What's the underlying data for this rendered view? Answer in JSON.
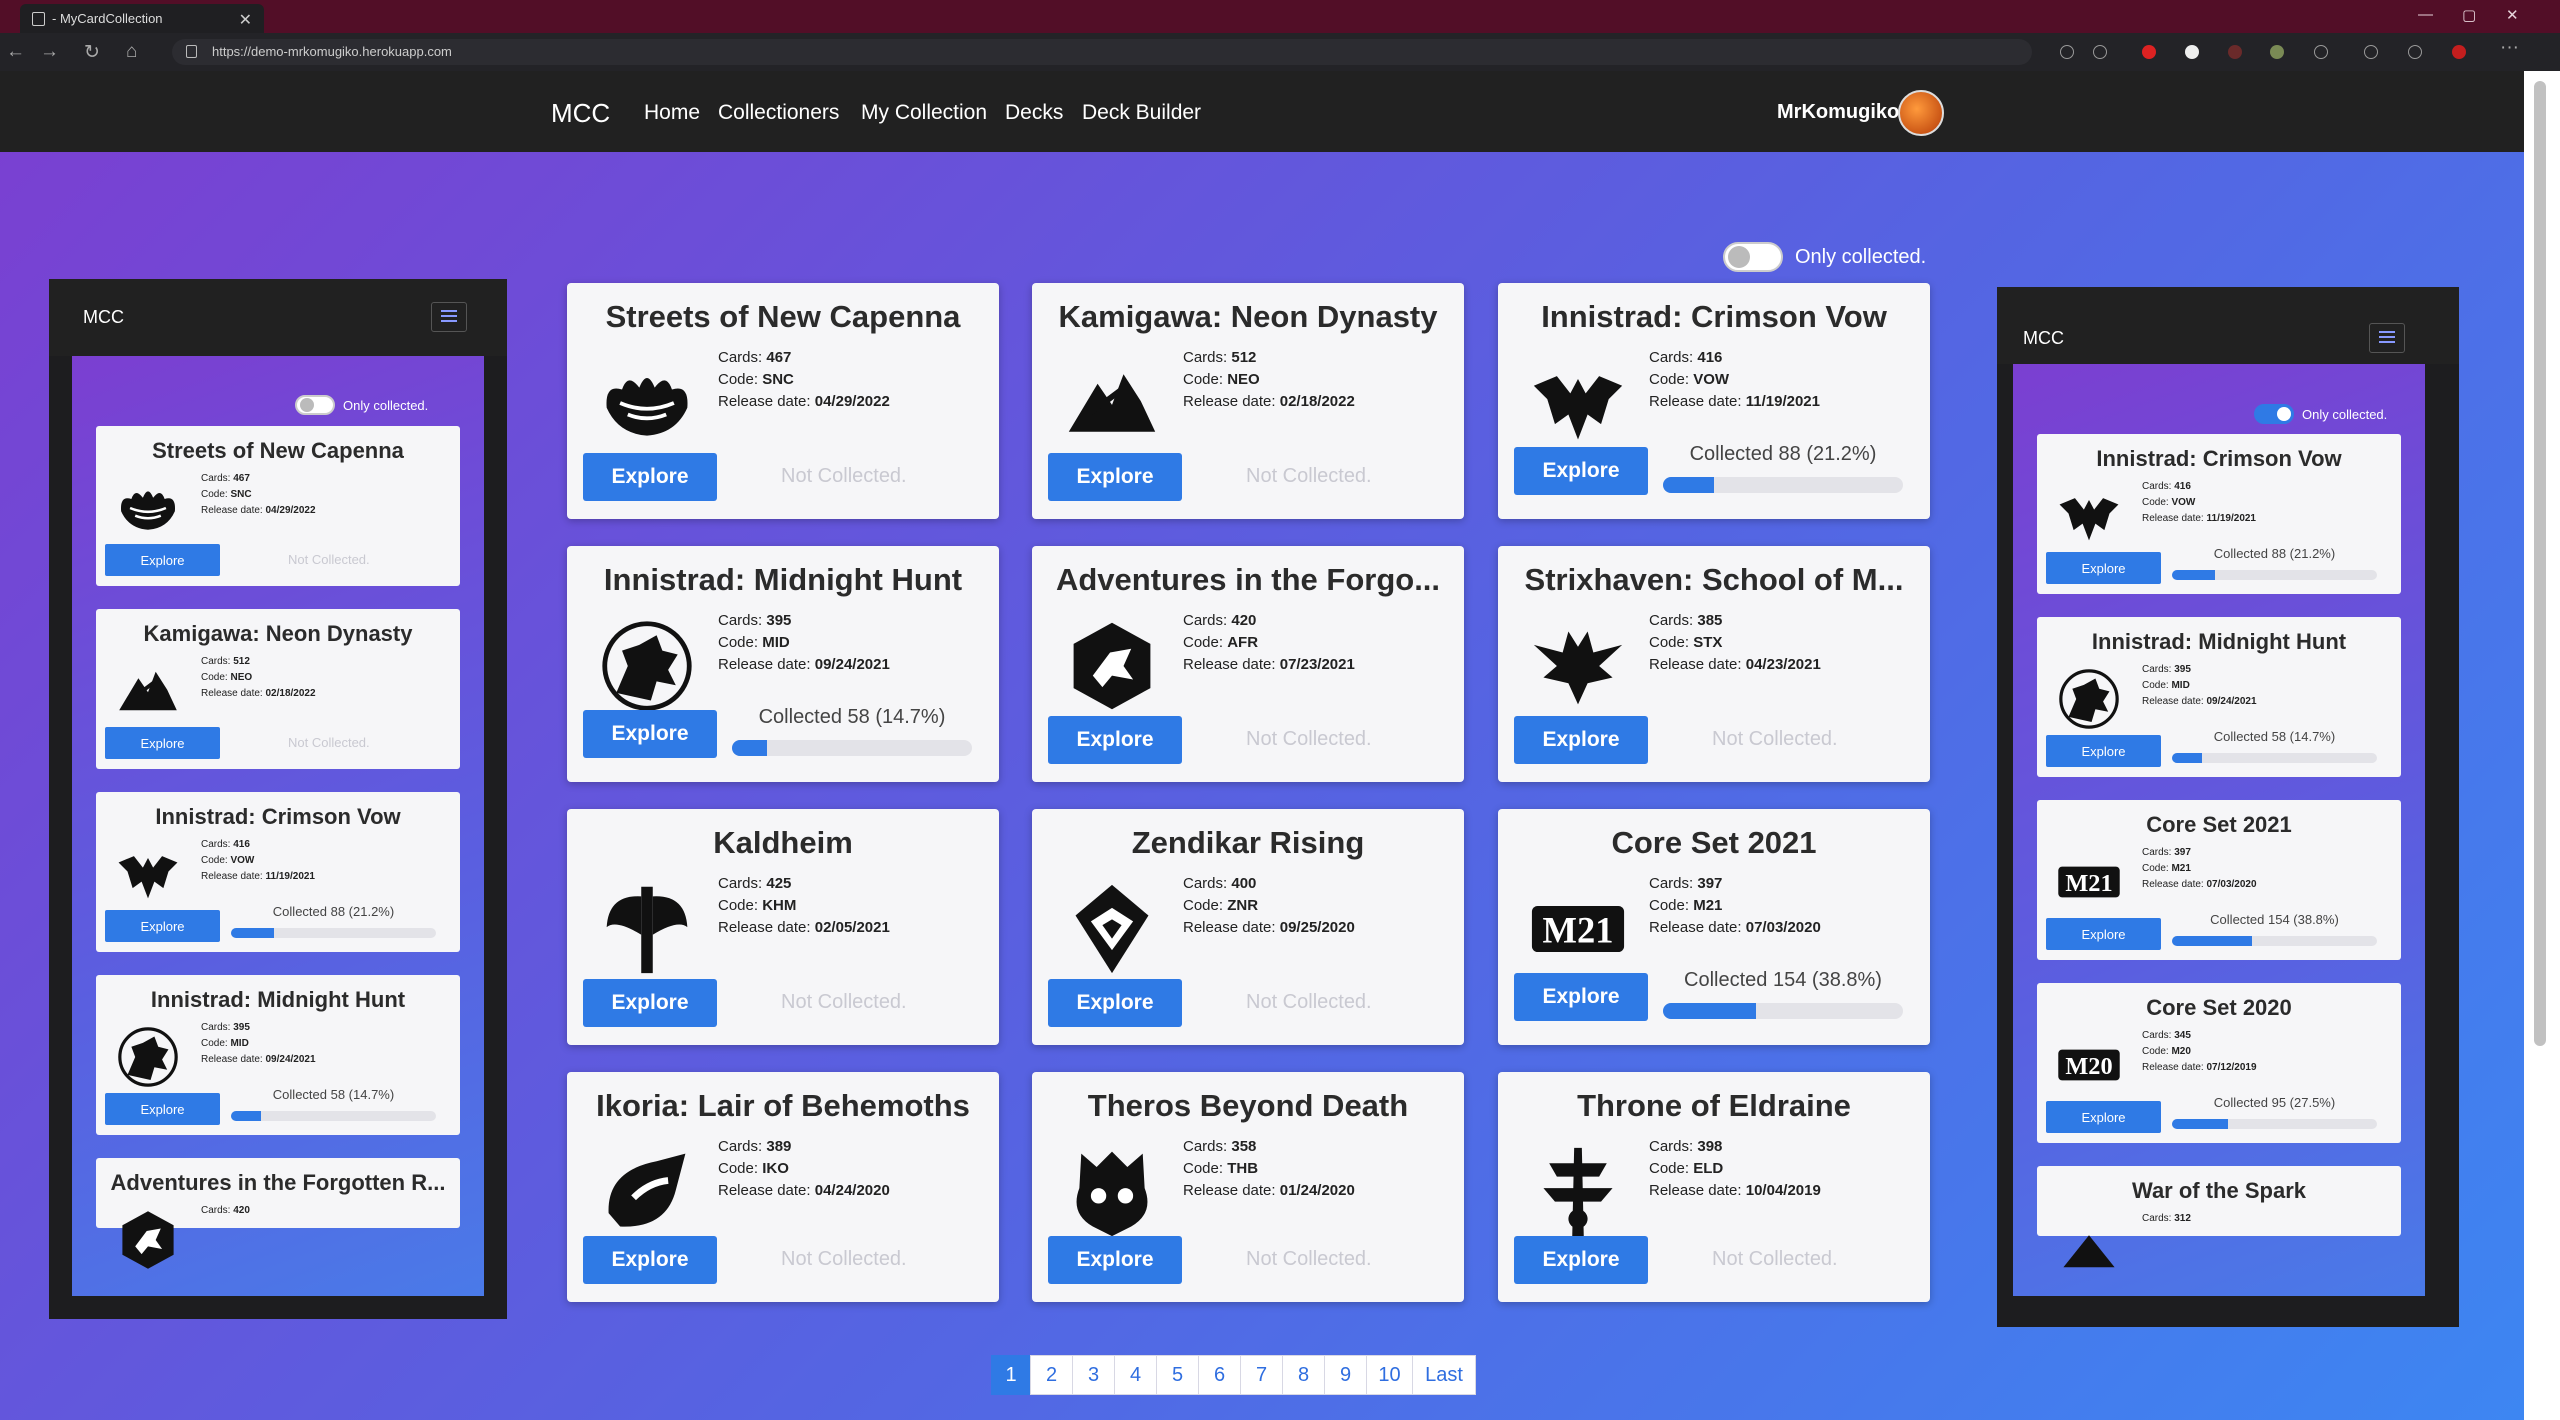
{
  "browser": {
    "tab_title": "- MyCardCollection",
    "url": "https://demo-mrkomugiko.herokuapp.com"
  },
  "nav": {
    "brand": "MCC",
    "links": [
      "Home",
      "Collectioners",
      "My Collection",
      "Decks",
      "Deck Builder"
    ],
    "user": "MrKomugiko"
  },
  "filter": {
    "label": "Only collected."
  },
  "labels": {
    "cards": "Cards:",
    "code": "Code:",
    "release": "Release date:",
    "explore": "Explore",
    "not_collected": "Not Collected."
  },
  "sets": [
    {
      "title": "Streets of New Capenna",
      "cards": "467",
      "code": "SNC",
      "release": "04/29/2022",
      "icon": "snc-set-icon",
      "collected": null
    },
    {
      "title": "Kamigawa: Neon Dynasty",
      "cards": "512",
      "code": "NEO",
      "release": "02/18/2022",
      "icon": "neo-set-icon",
      "collected": null
    },
    {
      "title": "Innistrad: Crimson Vow",
      "cards": "416",
      "code": "VOW",
      "release": "11/19/2021",
      "icon": "vow-set-icon",
      "collected": "Collected 88 (21.2%)",
      "pct": 21.2
    },
    {
      "title": "Innistrad: Midnight Hunt",
      "cards": "395",
      "code": "MID",
      "release": "09/24/2021",
      "icon": "mid-set-icon",
      "collected": "Collected 58 (14.7%)",
      "pct": 14.7
    },
    {
      "title": "Adventures in the Forgo...",
      "cards": "420",
      "code": "AFR",
      "release": "07/23/2021",
      "icon": "afr-set-icon",
      "collected": null
    },
    {
      "title": "Strixhaven: School of M...",
      "cards": "385",
      "code": "STX",
      "release": "04/23/2021",
      "icon": "stx-set-icon",
      "collected": null
    },
    {
      "title": "Kaldheim",
      "cards": "425",
      "code": "KHM",
      "release": "02/05/2021",
      "icon": "khm-set-icon",
      "collected": null
    },
    {
      "title": "Zendikar Rising",
      "cards": "400",
      "code": "ZNR",
      "release": "09/25/2020",
      "icon": "znr-set-icon",
      "collected": null
    },
    {
      "title": "Core Set 2021",
      "cards": "397",
      "code": "M21",
      "release": "07/03/2020",
      "icon": "m21-set-icon",
      "collected": "Collected 154 (38.8%)",
      "pct": 38.8
    },
    {
      "title": "Ikoria: Lair of Behemoths",
      "cards": "389",
      "code": "IKO",
      "release": "04/24/2020",
      "icon": "iko-set-icon",
      "collected": null
    },
    {
      "title": "Theros Beyond Death",
      "cards": "358",
      "code": "THB",
      "release": "01/24/2020",
      "icon": "thb-set-icon",
      "collected": null
    },
    {
      "title": "Throne of Eldraine",
      "cards": "398",
      "code": "ELD",
      "release": "10/04/2019",
      "icon": "eld-set-icon",
      "collected": null
    }
  ],
  "pagination": [
    "1",
    "2",
    "3",
    "4",
    "5",
    "6",
    "7",
    "8",
    "9",
    "10",
    "Last"
  ],
  "left_preview": {
    "brand": "MCC",
    "filter": "Only collected.",
    "cards": [
      {
        "title": "Streets of New Capenna",
        "cards": "467",
        "code": "SNC",
        "release": "04/29/2022",
        "icon": "snc-set-icon",
        "collected": null
      },
      {
        "title": "Kamigawa: Neon Dynasty",
        "cards": "512",
        "code": "NEO",
        "release": "02/18/2022",
        "icon": "neo-set-icon",
        "collected": null
      },
      {
        "title": "Innistrad: Crimson Vow",
        "cards": "416",
        "code": "VOW",
        "release": "11/19/2021",
        "icon": "vow-set-icon",
        "collected": "Collected 88 (21.2%)",
        "pct": 21.2
      },
      {
        "title": "Innistrad: Midnight Hunt",
        "cards": "395",
        "code": "MID",
        "release": "09/24/2021",
        "icon": "mid-set-icon",
        "collected": "Collected 58 (14.7%)",
        "pct": 14.7
      },
      {
        "title": "Adventures in the Forgotten R...",
        "cards": "420",
        "code": "",
        "release": "",
        "icon": "afr-set-icon",
        "collected": null
      }
    ]
  },
  "right_preview": {
    "brand": "MCC",
    "filter": "Only collected.",
    "cards": [
      {
        "title": "Innistrad: Crimson Vow",
        "cards": "416",
        "code": "VOW",
        "release": "11/19/2021",
        "icon": "vow-set-icon",
        "collected": "Collected 88 (21.2%)",
        "pct": 21.2
      },
      {
        "title": "Innistrad: Midnight Hunt",
        "cards": "395",
        "code": "MID",
        "release": "09/24/2021",
        "icon": "mid-set-icon",
        "collected": "Collected 58 (14.7%)",
        "pct": 14.7
      },
      {
        "title": "Core Set 2021",
        "cards": "397",
        "code": "M21",
        "release": "07/03/2020",
        "icon": "m21-set-icon",
        "collected": "Collected 154 (38.8%)",
        "pct": 38.8
      },
      {
        "title": "Core Set 2020",
        "cards": "345",
        "code": "M20",
        "release": "07/12/2019",
        "icon": "m20-set-icon",
        "collected": "Collected 95 (27.5%)",
        "pct": 27.5
      },
      {
        "title": "War of the Spark",
        "cards": "312",
        "code": "",
        "release": "",
        "icon": "war-set-icon",
        "collected": null
      }
    ]
  },
  "colors": {
    "accent": "#2f7ae5",
    "navbar": "#212121",
    "titlebar": "#520e27"
  }
}
